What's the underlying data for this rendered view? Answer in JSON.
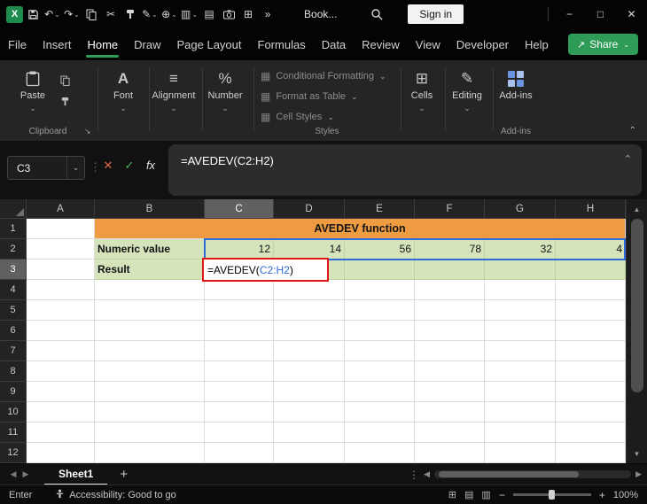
{
  "titlebar": {
    "workbook_name": "Book...",
    "sign_in": "Sign in"
  },
  "menu": {
    "tabs": [
      "File",
      "Insert",
      "Home",
      "Draw",
      "Page Layout",
      "Formulas",
      "Data",
      "Review",
      "View",
      "Developer",
      "Help"
    ],
    "active_tab": "Home",
    "share": "Share"
  },
  "ribbon": {
    "paste": "Paste",
    "clipboard_group": "Clipboard",
    "font": "Font",
    "alignment": "Alignment",
    "number": "Number",
    "conditional_formatting": "Conditional Formatting",
    "format_as_table": "Format as Table",
    "cell_styles": "Cell Styles",
    "styles_group": "Styles",
    "cells": "Cells",
    "editing": "Editing",
    "addins": "Add-ins",
    "addins_group": "Add-ins"
  },
  "formula_bar": {
    "name_box": "C3",
    "fx": "fx",
    "formula": "=AVEDEV(C2:H2)"
  },
  "grid": {
    "col_headers": [
      "A",
      "B",
      "C",
      "D",
      "E",
      "F",
      "G",
      "H"
    ],
    "row_headers": [
      "1",
      "2",
      "3",
      "4",
      "5",
      "6",
      "7",
      "8",
      "9",
      "10",
      "11",
      "12"
    ],
    "title": "AVEDEV function",
    "numeric_label": "Numeric value",
    "values": [
      "12",
      "14",
      "56",
      "78",
      "32",
      "4"
    ],
    "result_label": "Result",
    "edit_formula": {
      "prefix": "=AVEDEV(",
      "range": "C2:H2",
      "suffix": ")"
    }
  },
  "sheet_bar": {
    "sheet": "Sheet1"
  },
  "status_bar": {
    "mode": "Enter",
    "accessibility": "Accessibility: Good to go",
    "zoom": "100%"
  },
  "colors": {
    "accent_green": "#2E9B57",
    "orange_fill": "#EE9B41",
    "green_fill": "#D6E4BC",
    "range_border": "#2F6BD7",
    "edit_border": "#E01515"
  }
}
